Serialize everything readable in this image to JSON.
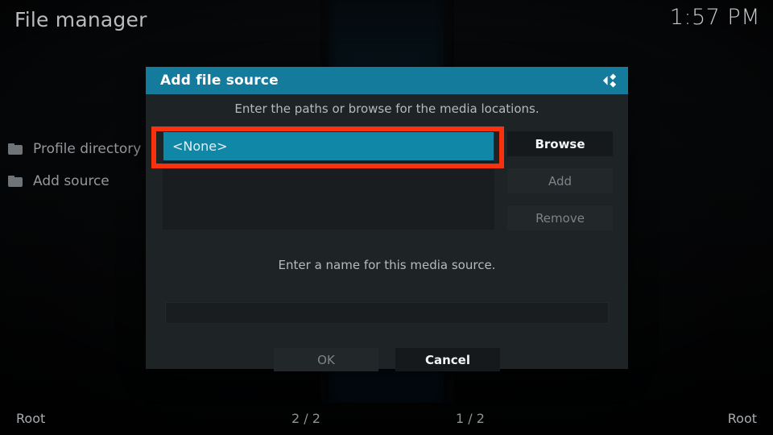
{
  "window": {
    "title": "File manager",
    "clock": "1:57 PM"
  },
  "background_list": {
    "items": [
      {
        "icon": "folder-icon",
        "label": "Profile directory"
      },
      {
        "icon": "folder-icon",
        "label": "Add source"
      }
    ]
  },
  "footer": {
    "left_path": "Root",
    "left_count": "2 / 2",
    "right_count": "1 / 2",
    "right_path": "Root"
  },
  "dialog": {
    "title": "Add file source",
    "logo_icon": "kodi-logo-icon",
    "paths_hint": "Enter the paths or browse for the media locations.",
    "path_entries": [
      {
        "label": "<None>",
        "selected": true
      }
    ],
    "side_buttons": [
      {
        "label": "Browse",
        "enabled": true
      },
      {
        "label": "Add",
        "enabled": false
      },
      {
        "label": "Remove",
        "enabled": false
      }
    ],
    "name_hint": "Enter a name for this media source.",
    "name_value": "",
    "name_placeholder": "",
    "bottom_buttons": [
      {
        "label": "OK",
        "enabled": false
      },
      {
        "label": "Cancel",
        "enabled": true
      }
    ]
  },
  "annotation": {
    "target": "path-entry-none",
    "color": "#f8320c"
  },
  "colors": {
    "accent_teal": "#147b9c",
    "selected_teal": "#1187a7",
    "dialog_bg": "#1e2326",
    "panel_bg": "#191d1f",
    "annotation_red": "#f8320c"
  }
}
